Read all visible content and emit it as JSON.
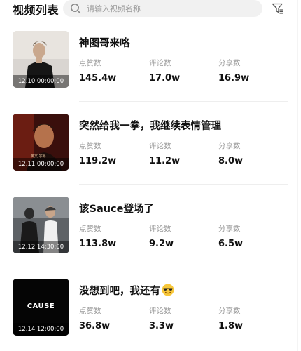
{
  "header": {
    "title": "视频列表",
    "search_placeholder": "请输入视频名称"
  },
  "stat_labels": {
    "likes": "点赞数",
    "comments": "评论数",
    "shares": "分享数"
  },
  "videos": [
    {
      "title": "神图哥来咯",
      "timestamp": "12.10 00:00:00",
      "likes": "145.4w",
      "comments": "17.0w",
      "shares": "16.9w"
    },
    {
      "title": "突然给我一拳，我继续表情管理",
      "timestamp": "12.11 00:00:00",
      "likes": "119.2w",
      "comments": "11.2w",
      "shares": "8.0w"
    },
    {
      "title": "该Sauce登场了",
      "timestamp": "12.12 14:30:00",
      "likes": "113.8w",
      "comments": "9.2w",
      "shares": "6.5w"
    },
    {
      "title": "没想到吧，我还有",
      "timestamp": "12.14 12:00:00",
      "likes": "36.8w",
      "comments": "3.3w",
      "shares": "1.8w",
      "thumb_text": "CAUSE",
      "title_emoji": "sunglasses-emoji"
    }
  ]
}
